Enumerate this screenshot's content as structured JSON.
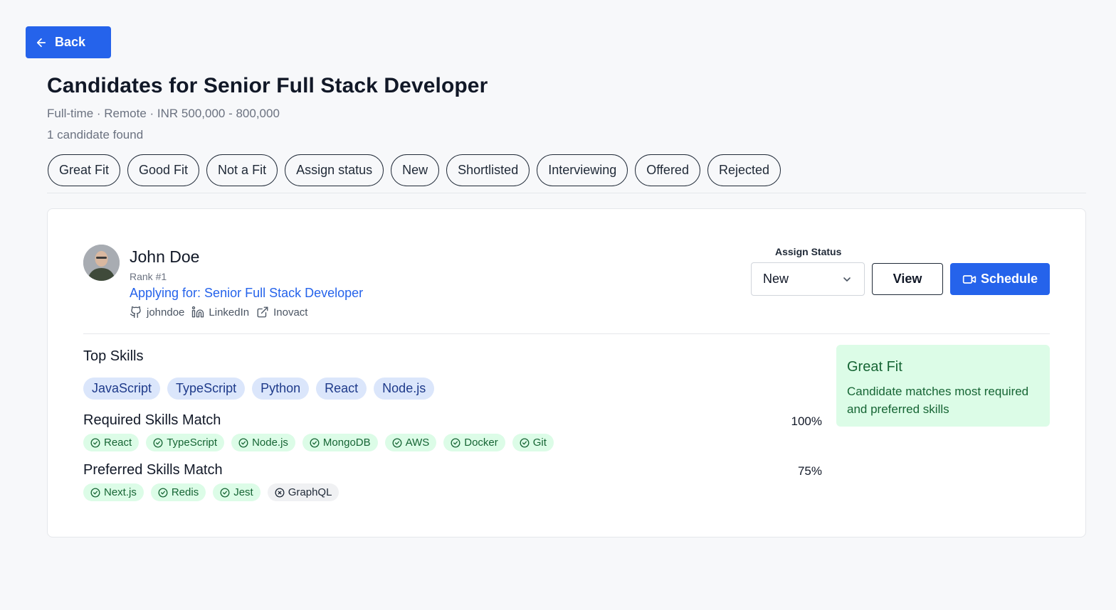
{
  "nav": {
    "back_label": "Back"
  },
  "header": {
    "title": "Candidates for Senior Full Stack Developer",
    "meta": "Full-time · Remote · INR 500,000 - 800,000",
    "count": "1 candidate found"
  },
  "filters": [
    "Great Fit",
    "Good Fit",
    "Not a Fit",
    "Assign status",
    "New",
    "Shortlisted",
    "Interviewing",
    "Offered",
    "Rejected"
  ],
  "candidate": {
    "name": "John Doe",
    "rank": "Rank #1",
    "applying": "Applying for: Senior Full Stack Developer",
    "github": "johndoe",
    "linkedin": "LinkedIn",
    "portfolio": "Inovact",
    "status_label": "Assign Status",
    "status_value": "New",
    "view_label": "View",
    "schedule_label": "Schedule",
    "top_skills_title": "Top Skills",
    "top_skills": [
      "JavaScript",
      "TypeScript",
      "Python",
      "React",
      "Node.js"
    ],
    "required_title": "Required Skills Match",
    "required_pct": "100%",
    "required_skills": [
      {
        "name": "React",
        "matched": true
      },
      {
        "name": "TypeScript",
        "matched": true
      },
      {
        "name": "Node.js",
        "matched": true
      },
      {
        "name": "MongoDB",
        "matched": true
      },
      {
        "name": "AWS",
        "matched": true
      },
      {
        "name": "Docker",
        "matched": true
      },
      {
        "name": "Git",
        "matched": true
      }
    ],
    "preferred_title": "Preferred Skills Match",
    "preferred_pct": "75%",
    "preferred_skills": [
      {
        "name": "Next.js",
        "matched": true
      },
      {
        "name": "Redis",
        "matched": true
      },
      {
        "name": "Jest",
        "matched": true
      },
      {
        "name": "GraphQL",
        "matched": false
      }
    ],
    "fit_title": "Great Fit",
    "fit_desc": "Candidate matches most required and preferred skills"
  },
  "colors": {
    "accent": "#2563eb",
    "match_bg": "#dcfce7",
    "match_text": "#166534",
    "skill_bg": "#dbe6fb"
  }
}
